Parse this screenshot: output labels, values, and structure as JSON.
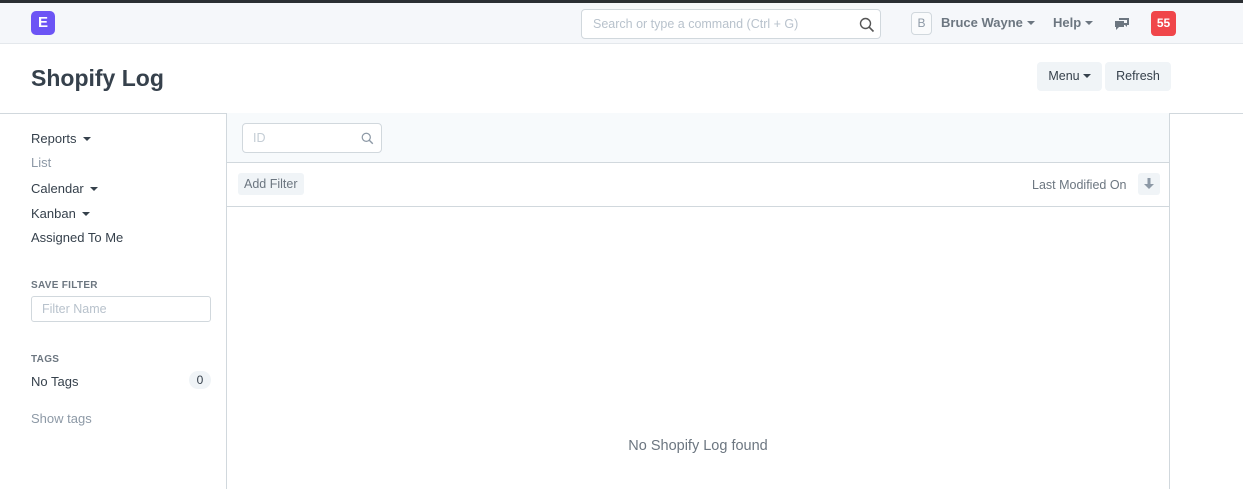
{
  "navbar": {
    "logo_letter": "E",
    "search_placeholder": "Search or type a command (Ctrl + G)",
    "avatar_letter": "B",
    "user_name": "Bruce Wayne",
    "help_label": "Help",
    "notification_count": "55"
  },
  "page": {
    "title": "Shopify Log",
    "menu_label": "Menu",
    "refresh_label": "Refresh"
  },
  "sidebar": {
    "reports": "Reports",
    "list": "List",
    "calendar": "Calendar",
    "kanban": "Kanban",
    "assigned_to_me": "Assigned To Me",
    "save_filter_heading": "SAVE FILTER",
    "filter_name_placeholder": "Filter Name",
    "tags_heading": "TAGS",
    "no_tags": "No Tags",
    "no_tags_count": "0",
    "show_tags": "Show tags"
  },
  "list": {
    "id_placeholder": "ID",
    "add_filter": "Add Filter",
    "sort_label": "Last Modified On",
    "empty_message": "No Shopify Log found"
  },
  "colors": {
    "logo": "#6c54f5",
    "notification": "#f0464a"
  }
}
